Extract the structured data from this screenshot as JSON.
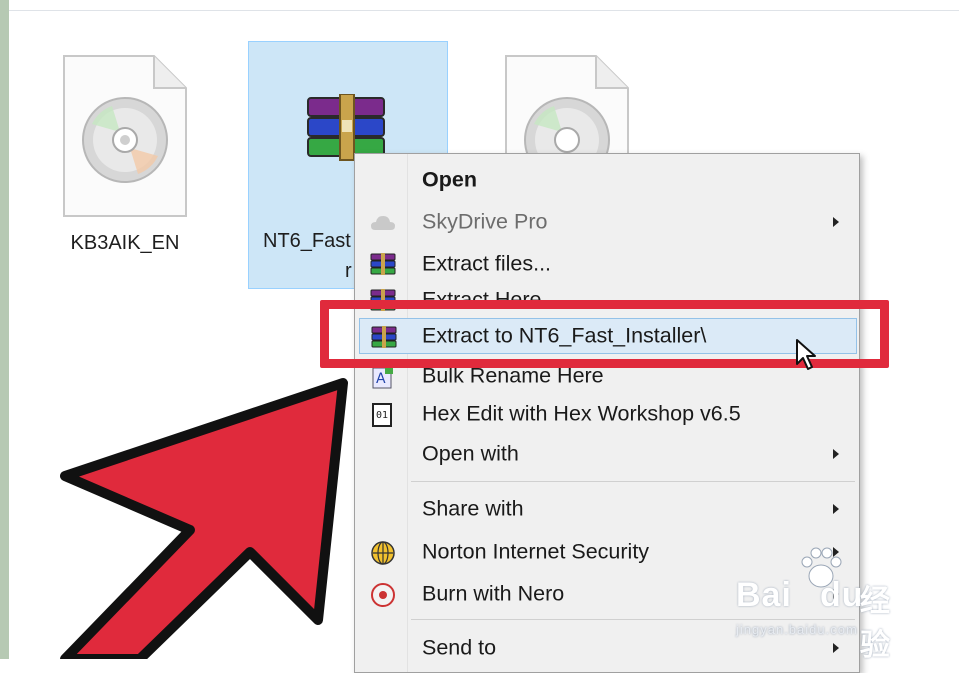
{
  "files": [
    {
      "name": "KB3AIK_EN",
      "icon": "disc-image-file-icon"
    },
    {
      "name": "NT6_Fast",
      "name_wrap": "r",
      "icon": "winrar-archive-icon",
      "selected": true
    },
    {
      "name": "",
      "icon": "disc-image-file-icon"
    }
  ],
  "context_menu": {
    "items": [
      {
        "label": "Open",
        "bold": true
      },
      {
        "label": "SkyDrive Pro",
        "disabled": true,
        "submenu": true,
        "icon": "skydrive-icon"
      },
      {
        "label": "Extract files...",
        "icon": "winrar-icon"
      },
      {
        "label": "Extract Here",
        "icon": "winrar-icon"
      },
      {
        "label": "Extract to NT6_Fast_Installer\\",
        "icon": "winrar-icon",
        "highlighted": true
      },
      {
        "label": "Bulk Rename Here",
        "icon": "bulk-rename-icon"
      },
      {
        "label": "Hex Edit with Hex Workshop v6.5",
        "icon": "hex-workshop-icon"
      },
      {
        "label": "Open with",
        "submenu": true
      },
      {
        "label": "Share with",
        "submenu": true
      },
      {
        "label": "Norton Internet Security",
        "submenu": true,
        "icon": "norton-icon"
      },
      {
        "label": "Burn with Nero",
        "submenu": true,
        "icon": "nero-icon"
      },
      {
        "label": "Send to",
        "submenu": true
      }
    ]
  },
  "annotation": {
    "highlight_color": "#e02a3c",
    "arrow_color": "#e02a3c"
  },
  "watermark": {
    "brand": "Bai",
    "brand2": "du",
    "cn": "经验",
    "url": "jingyan.baidu.com"
  }
}
